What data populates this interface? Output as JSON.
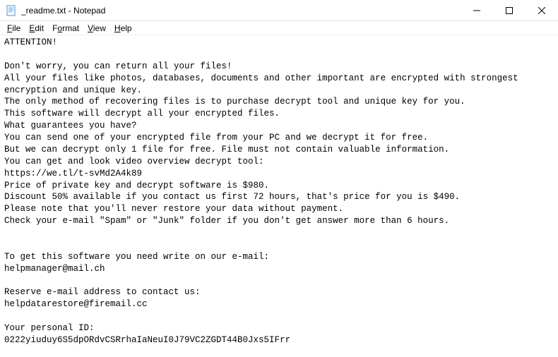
{
  "window": {
    "title": "_readme.txt - Notepad"
  },
  "menu": {
    "file": "File",
    "edit": "Edit",
    "format": "Format",
    "view": "View",
    "help": "Help"
  },
  "content": {
    "text": "ATTENTION!\n\nDon't worry, you can return all your files!\nAll your files like photos, databases, documents and other important are encrypted with strongest encryption and unique key.\nThe only method of recovering files is to purchase decrypt tool and unique key for you.\nThis software will decrypt all your encrypted files.\nWhat guarantees you have?\nYou can send one of your encrypted file from your PC and we decrypt it for free.\nBut we can decrypt only 1 file for free. File must not contain valuable information.\nYou can get and look video overview decrypt tool:\nhttps://we.tl/t-svMd2A4k89\nPrice of private key and decrypt software is $980.\nDiscount 50% available if you contact us first 72 hours, that's price for you is $490.\nPlease note that you'll never restore your data without payment.\nCheck your e-mail \"Spam\" or \"Junk\" folder if you don't get answer more than 6 hours.\n\n\nTo get this software you need write on our e-mail:\nhelpmanager@mail.ch\n\nReserve e-mail address to contact us:\nhelpdatarestore@firemail.cc\n\nYour personal ID:\n0222yiuduy6S5dpORdvCSRrhaIaNeuI0J79VC2ZGDT44B0Jxs5IFrr"
  }
}
